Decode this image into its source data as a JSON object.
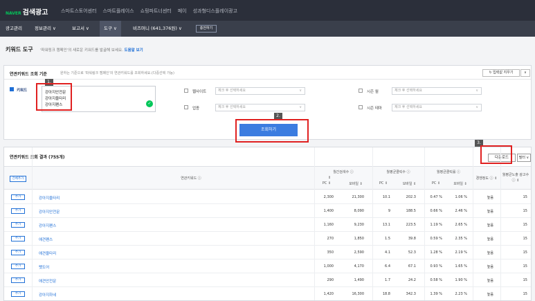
{
  "brand": {
    "naver": "NAVER",
    "name": "검색광고"
  },
  "topnav": [
    "스마트스토어센터",
    "스마트플레이스",
    "쇼핑파트너센터",
    "페이",
    "성과형디스플레이광고"
  ],
  "menus": {
    "ad_manage": "광고관리",
    "info_manage": "정보관리 ∨",
    "report": "보고서 ∨",
    "tools": "도구 ∨",
    "bizmoney": "비즈머니 (641,376원) ∨",
    "charge_btn": "충전하기"
  },
  "page": {
    "title": "키워드 도구",
    "desc": "'파워링크 캠페인'의 새로운 키워드를 발굴해 보세요.",
    "help": "도움말 보기"
  },
  "search_panel": {
    "title": "연관키워드 조회 기준",
    "subtitle": "원하는 기준으로 '파워링크 캠페인'의 연관키워드를 조회하세요.(다중선택 가능)",
    "reset": "입력값 지우기",
    "reset_arrow": "∨",
    "keyword_label": "키워드",
    "keywords": [
      "강아지안전문",
      "강아지울타리",
      "강아지펜스"
    ],
    "website_label": "웹사이트",
    "industry_label": "업종",
    "season_month_label": "시즌 월",
    "season_theme_label": "시즌 테마",
    "select_placeholder": "체크 후 선택하세요",
    "search_btn": "조회하기"
  },
  "markers": [
    "1.",
    "2.",
    "3."
  ],
  "results": {
    "title": "연관키워드 조회 결과 (755개)",
    "download": "다운로드",
    "filter": "필터 ∨",
    "add_all": "전체추가",
    "add": "추가",
    "col_keyword": "연관키워드 ⓘ",
    "col_monthly_search": "월간검색수 ⓘ",
    "col_monthly_clicks": "월평균클릭수 ⓘ",
    "col_monthly_ctr": "월평균클릭률 ⓘ",
    "col_competition": "경쟁정도 ⓘ ⇕",
    "col_ad_count": "월평균노출 광고수 ⓘ ⇕",
    "sub_pc": "PC ⇕",
    "sub_mobile": "모바일 ⇕",
    "rows": [
      {
        "keyword": "강아지울타리",
        "pc": "2,300",
        "mobile": "21,300",
        "clk_pc": "10.1",
        "clk_mo": "202.3",
        "ctr_pc": "0.47 %",
        "ctr_mo": "1.06 %",
        "comp": "높음",
        "ads": "15"
      },
      {
        "keyword": "강아지안전문",
        "pc": "1,400",
        "mobile": "8,090",
        "clk_pc": "9",
        "clk_mo": "188.5",
        "ctr_pc": "0.66 %",
        "ctr_mo": "2.46 %",
        "comp": "높음",
        "ads": "15"
      },
      {
        "keyword": "강아지펜스",
        "pc": "1,160",
        "mobile": "9,230",
        "clk_pc": "13.1",
        "clk_mo": "223.5",
        "ctr_pc": "1.19 %",
        "ctr_mo": "2.65 %",
        "comp": "높음",
        "ads": "15"
      },
      {
        "keyword": "애견펜스",
        "pc": "270",
        "mobile": "1,850",
        "clk_pc": "1.5",
        "clk_mo": "39.8",
        "ctr_pc": "0.59 %",
        "ctr_mo": "2.35 %",
        "comp": "높음",
        "ads": "15"
      },
      {
        "keyword": "애견울타리",
        "pc": "350",
        "mobile": "2,590",
        "clk_pc": "4.1",
        "clk_mo": "52.3",
        "ctr_pc": "1.28 %",
        "ctr_mo": "2.19 %",
        "comp": "높음",
        "ads": "15"
      },
      {
        "keyword": "펫도어",
        "pc": "1,000",
        "mobile": "4,170",
        "clk_pc": "6.4",
        "clk_mo": "67.1",
        "ctr_pc": "0.93 %",
        "ctr_mo": "1.65 %",
        "comp": "높음",
        "ads": "15"
      },
      {
        "keyword": "애견안전문",
        "pc": "290",
        "mobile": "1,490",
        "clk_pc": "1.7",
        "clk_mo": "24.2",
        "ctr_pc": "0.58 %",
        "ctr_mo": "1.90 %",
        "comp": "높음",
        "ads": "15"
      },
      {
        "keyword": "강아지하네",
        "pc": "1,420",
        "mobile": "16,300",
        "clk_pc": "18.8",
        "clk_mo": "342.3",
        "ctr_pc": "1.39 %",
        "ctr_mo": "2.23 %",
        "comp": "높음",
        "ads": "15"
      }
    ]
  }
}
